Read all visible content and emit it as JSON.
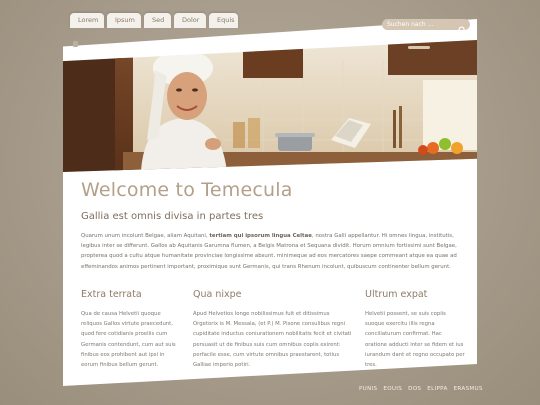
{
  "nav": {
    "tabs": [
      "Lorem",
      "Ipsum",
      "Sed",
      "Dolor",
      "Equis"
    ]
  },
  "search": {
    "placeholder": "Suchen nach ..."
  },
  "main": {
    "title": "Welcome to Temecula",
    "subtitle": "Gallia est omnis divisa in partes tres",
    "intro_before": "Quarum unum incolunt Belgae, aliam Aquitani, ",
    "intro_strong": "tertiam qui ipsorum lingua Celtae",
    "intro_after": ", nostra Galli appellantur. Hi omnes lingua, institutis, legibus inter se differunt. Gallos ab Aquitanis Garumna flumen, a Belgis Matrona et Sequana dividit. Horum omnium fortissimi sunt Belgae, propterea quod a cultu atque humanitate provinciae longissime absunt, minimeque ad eos mercatores saepe commeant atque ea quae ad effeminandos animos pertinent important, proximique sunt Germanis, qui trans Rhenum incolunt, quibuscum continenter bellum gerunt."
  },
  "columns": [
    {
      "heading": "Extra terrata",
      "text": "Qua de causa Helvetii quoque reliquos Gallos virtute praecedunt, quod fere cotidianis proeliis cum Germanis contendunt, cum aut suis finibus eos prohibent aut ipsi in eorum finibus bellum gerunt."
    },
    {
      "heading": "Qua nixpe",
      "text": "Apud Helvetios longe nobilissimus fuit et ditissimus Orgetorix is M. Messala, (et P.) M. Pisone consulibus regni cupiditate inductus coniurationem nobilitatis fecit et civitati persuasit ut de finibus suis cum omnibus copiis exirent: perfacile esse, cum virtute omnibus praestarent, totius Galliae imperio potiri."
    },
    {
      "heading": "Ultrum expat",
      "text": "Helvetii possent, se suis copiis suoque exercitu illis regna conciliaturum confirmat. Hac oratione adducti inter se fidem et ius iurandum dant et regno occupato per tres."
    }
  ],
  "footer": {
    "links": [
      "PUNIS",
      "EOUIS",
      "DOS",
      "ELIPPA",
      "ERASMUS"
    ]
  }
}
